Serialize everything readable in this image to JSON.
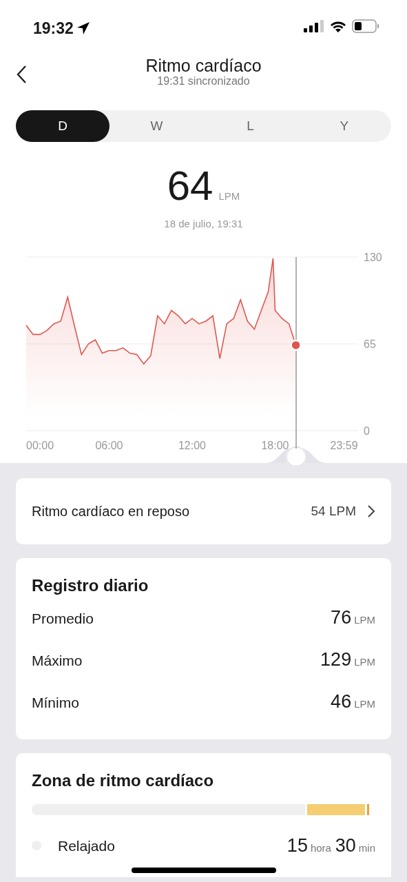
{
  "status_bar": {
    "time": "19:32"
  },
  "header": {
    "title": "Ritmo cardíaco",
    "subtitle": "19:31 sincronizado"
  },
  "tabs": [
    {
      "label": "D",
      "selected": true
    },
    {
      "label": "W",
      "selected": false
    },
    {
      "label": "L",
      "selected": false
    },
    {
      "label": "Y",
      "selected": false
    }
  ],
  "reading": {
    "value": "64",
    "unit": "LPM",
    "date": "18 de julio, 19:31"
  },
  "chart": {
    "chart_data": {
      "type": "area",
      "x": [
        0,
        0.5,
        1,
        1.5,
        2,
        2.5,
        3,
        3.5,
        4,
        4.5,
        5,
        5.5,
        6,
        6.5,
        7,
        7.5,
        8,
        8.5,
        9,
        9.5,
        10,
        10.5,
        11,
        11.5,
        12,
        12.5,
        13,
        13.5,
        14,
        14.5,
        15,
        15.5,
        16,
        16.5,
        17,
        17.5,
        17.85,
        18,
        18.5,
        19,
        19.5
      ],
      "series": [
        {
          "color": "#e0574f",
          "values": [
            79,
            72,
            72,
            75,
            80,
            82,
            100,
            78,
            57,
            65,
            68,
            58,
            60,
            60,
            62,
            58,
            57,
            50,
            56,
            86,
            80,
            90,
            86,
            80,
            84,
            80,
            82,
            86,
            54,
            80,
            84,
            98,
            82,
            76,
            90,
            104,
            129,
            90,
            84,
            80,
            64
          ]
        }
      ],
      "ref_lines": [
        {
          "axis": "x",
          "value": 19.52
        }
      ],
      "xlim": [
        0,
        24
      ],
      "ylim": [
        0,
        130
      ],
      "xticks": [
        {
          "value": 0,
          "label": "00:00"
        },
        {
          "value": 6,
          "label": "06:00"
        },
        {
          "value": 12,
          "label": "12:00"
        },
        {
          "value": 18,
          "label": "18:00"
        },
        {
          "value": 23.98,
          "label": "23:59"
        }
      ],
      "yticks": [
        0,
        65,
        130
      ]
    }
  },
  "resting": {
    "label": "Ritmo cardíaco en reposo",
    "value": "54 LPM"
  },
  "daily": {
    "title": "Registro diario",
    "rows": [
      {
        "label": "Promedio",
        "value": "76",
        "unit": "LPM"
      },
      {
        "label": "Máximo",
        "value": "129",
        "unit": "LPM"
      },
      {
        "label": "Mínimo",
        "value": "46",
        "unit": "LPM"
      }
    ]
  },
  "zones": {
    "title": "Zona de ritmo cardíaco",
    "segments": [
      {
        "color": "#efefef"
      },
      {
        "color": "#f5cd72"
      },
      {
        "color": "#e9a03b"
      }
    ],
    "items": [
      {
        "label": "Relajado",
        "color": "#efefef",
        "hours": "15",
        "hours_unit": "hora",
        "minutes": "30",
        "minutes_unit": "min"
      }
    ]
  }
}
